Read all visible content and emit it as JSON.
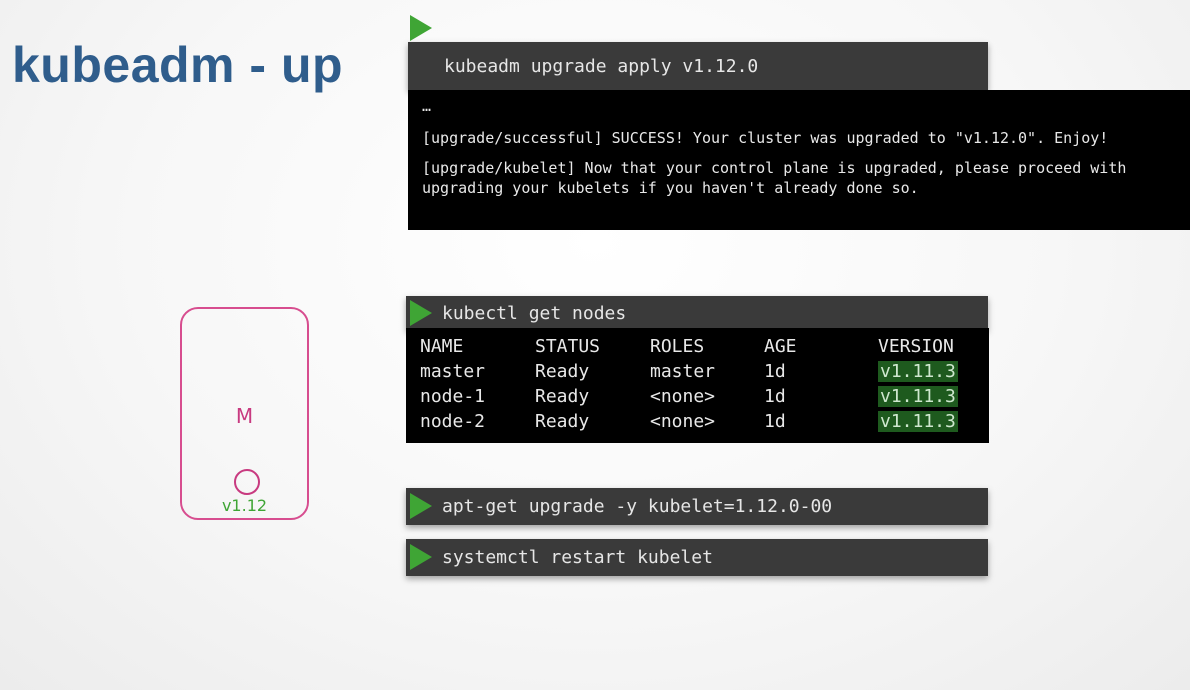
{
  "title": "kubeadm - up",
  "commands": {
    "upgrade_apply": "kubeadm upgrade apply v1.12.0",
    "get_nodes": "kubectl get nodes",
    "apt_upgrade": "apt-get upgrade -y kubelet=1.12.0-00",
    "restart": "systemctl restart kubelet"
  },
  "upgrade_output": {
    "ellipsis": "…",
    "line1": "[upgrade/successful] SUCCESS! Your cluster was upgraded to \"v1.12.0\". Enjoy!",
    "line2": "[upgrade/kubelet] Now that your control plane is upgraded, please proceed with",
    "line3": "upgrading your kubelets if you haven't already done so."
  },
  "nodes_table": {
    "headers": [
      "NAME",
      "STATUS",
      "ROLES",
      "AGE",
      "VERSION"
    ],
    "rows": [
      [
        "master",
        "Ready",
        "master",
        "1d",
        "v1.11.3"
      ],
      [
        "node-1",
        "Ready",
        "<none>",
        "1d",
        "v1.11.3"
      ],
      [
        "node-2",
        "Ready",
        "<none>",
        "1d",
        "v1.11.3"
      ]
    ]
  },
  "node": {
    "label": "M",
    "version": "v1.12"
  },
  "colors": {
    "title": "#2f5d8c",
    "play": "#3fa535",
    "node_border": "#d74d8f",
    "version_highlight": "#1e5a1e"
  }
}
